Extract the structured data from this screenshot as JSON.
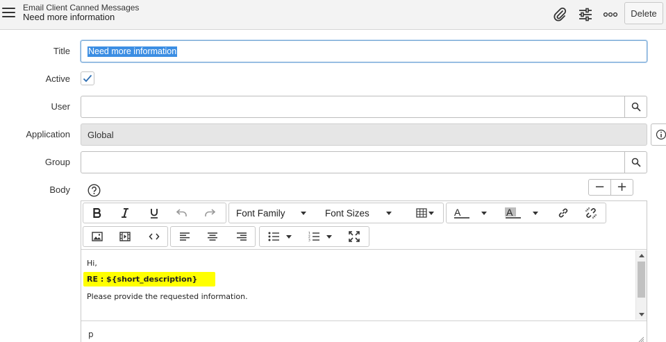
{
  "header": {
    "title": "Email Client Canned Messages",
    "subtitle": "Need more information",
    "icons": [
      "paperclip-icon",
      "settings-sliders-icon",
      "more-options-icon"
    ],
    "delete_label": "Delete"
  },
  "form": {
    "title_label": "Title",
    "title_value": "Need more information",
    "active_label": "Active",
    "active_checked": true,
    "user_label": "User",
    "user_value": "",
    "application_label": "Application",
    "application_value": "Global",
    "group_label": "Group",
    "group_value": "",
    "body_label": "Body"
  },
  "editor": {
    "font_family_label": "Font Family",
    "font_sizes_label": "Font Sizes",
    "zoom_minus": "−",
    "zoom_plus": "+",
    "content": {
      "line1": "Hi,",
      "line2": "RE : ${short_description}",
      "line3": "Please provide the requested information."
    },
    "status_path": "p"
  },
  "colors": {
    "accent": "#3c8ee3",
    "highlight": "#ffff00",
    "header_bg": "#f3f3f3"
  }
}
